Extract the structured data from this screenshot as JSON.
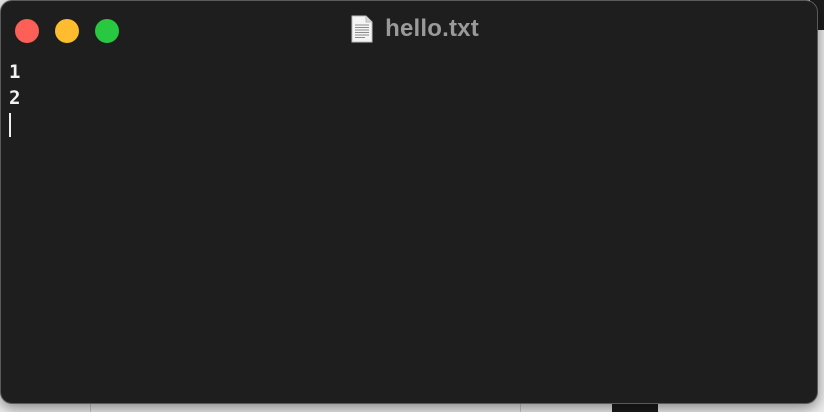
{
  "window": {
    "title": "hello.txt",
    "icon": "text-document-icon",
    "buttons": {
      "close_color": "#fe5f57",
      "minimize_color": "#febc2e",
      "zoom_color": "#28c840"
    }
  },
  "editor": {
    "lines": [
      "1",
      "2",
      ""
    ],
    "caret_line": 3
  }
}
